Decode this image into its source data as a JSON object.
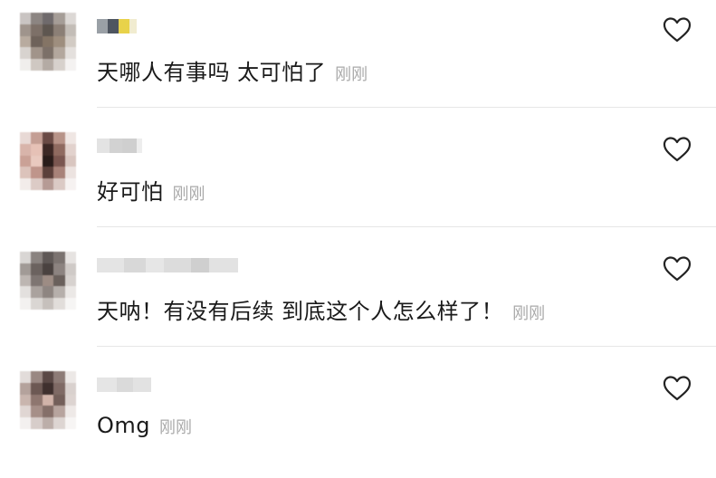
{
  "comments": [
    {
      "text": "天哪人有事吗 太可怕了",
      "time": "刚刚",
      "like_icon": "heart-outline-icon"
    },
    {
      "text": "好可怕",
      "time": "刚刚",
      "like_icon": "heart-outline-icon"
    },
    {
      "text": "天呐！有没有后续 到底这个人怎么样了！",
      "time": "刚刚",
      "like_icon": "heart-outline-icon"
    },
    {
      "text": "Omg",
      "time": "刚刚",
      "like_icon": "heart-outline-icon"
    }
  ],
  "colors": {
    "text": "#1a1a1a",
    "timestamp": "#a9a9a9",
    "divider": "#e6e6e6",
    "icon": "#222222"
  }
}
